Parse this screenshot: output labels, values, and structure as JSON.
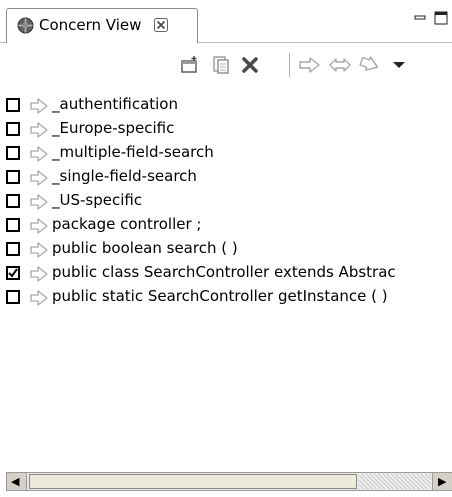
{
  "view": {
    "title": "Concern View",
    "close_glyph": "⊠",
    "tab_icon": "concern-view-icon"
  },
  "window_controls": [
    {
      "name": "minimize-icon"
    },
    {
      "name": "maximize-icon"
    }
  ],
  "toolbar": [
    {
      "name": "new-concern-icon"
    },
    {
      "name": "copy-icon"
    },
    {
      "name": "delete-icon"
    },
    {
      "name": "forward-arrow-icon"
    },
    {
      "name": "bidirectional-arrow-icon"
    },
    {
      "name": "backward-arrow-icon"
    },
    {
      "name": "view-menu-icon"
    }
  ],
  "concerns": [
    {
      "label": "_authentification",
      "checked": false
    },
    {
      "label": "_Europe-specific",
      "checked": false
    },
    {
      "label": "_multiple-field-search",
      "checked": false
    },
    {
      "label": "_single-field-search",
      "checked": false
    },
    {
      "label": "_US-specific",
      "checked": false
    },
    {
      "label": "package controller ;",
      "checked": false
    },
    {
      "label": "public boolean search ( )",
      "checked": false
    },
    {
      "label": "public class SearchController extends Abstrac",
      "checked": true
    },
    {
      "label": "public static SearchController getInstance ( )",
      "checked": false
    }
  ],
  "scrollbar": {
    "left_glyph": "◀",
    "right_glyph": "▶"
  }
}
